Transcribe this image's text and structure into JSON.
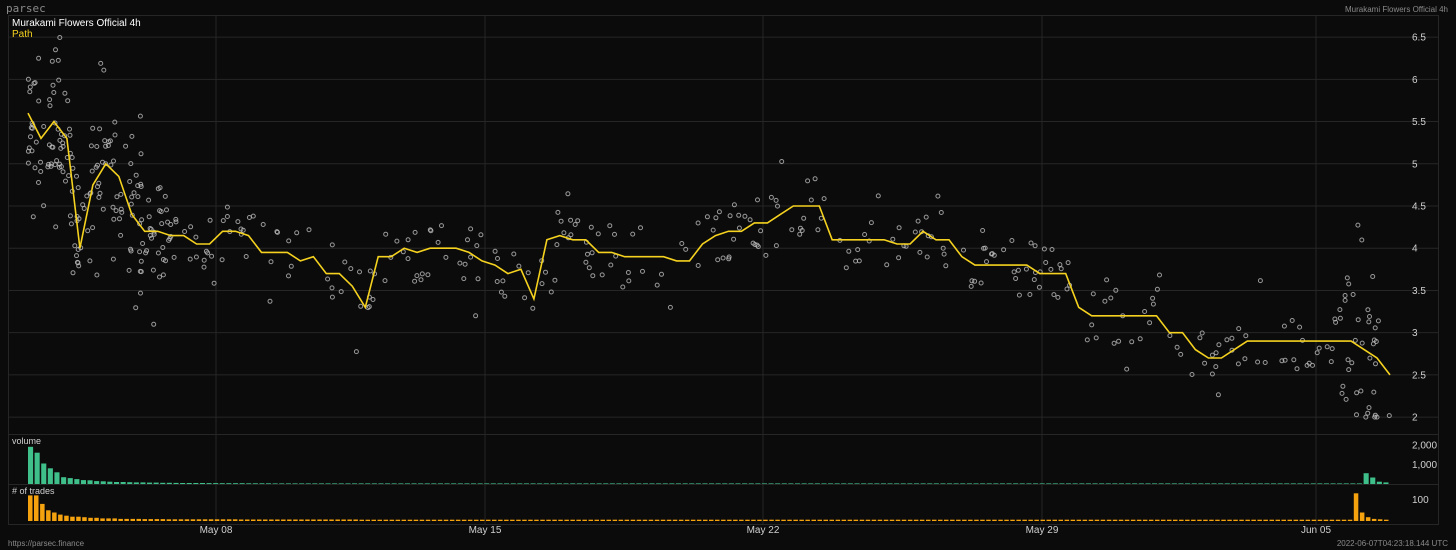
{
  "header": {
    "brand": "parsec",
    "window_label": "Murakami Flowers Official 4h"
  },
  "footer": {
    "url": "https://parsec.finance",
    "timestamp": "2022-06-07T04:23:18.144 UTC"
  },
  "colors": {
    "background": "#0b0b0b",
    "grid": "#262626",
    "path": "#f5d21f",
    "scatter": "#bdbdbd",
    "volume": "#3fbf8a",
    "trades": "#f5a20f",
    "title": "#ffffff"
  },
  "chart_data": [
    {
      "type": "scatter",
      "title": "Murakami Flowers Official 4h",
      "series": [
        {
          "name": "Path",
          "type": "line",
          "x": [
            0,
            2,
            4,
            6,
            8,
            10,
            12,
            14,
            16,
            18,
            20,
            22,
            24,
            26,
            28,
            30,
            32,
            34,
            36,
            38,
            40,
            42,
            44,
            46,
            48,
            50,
            52,
            54,
            56,
            58,
            60,
            62,
            64,
            66,
            68,
            70,
            72,
            74,
            76,
            78,
            80,
            82,
            84,
            86,
            88,
            90,
            92,
            94,
            96,
            98,
            100,
            102,
            104,
            106,
            108,
            110,
            112,
            114,
            116,
            118,
            120,
            122,
            124,
            126,
            128,
            130,
            132,
            134,
            136,
            138,
            140,
            142,
            144,
            146,
            148,
            150,
            152,
            154,
            156,
            158,
            160,
            162,
            164,
            166,
            168,
            170,
            172,
            174,
            176,
            178,
            180,
            182,
            184,
            186,
            188,
            190,
            192,
            194,
            196,
            198,
            200,
            202,
            204,
            206,
            208,
            210
          ],
          "y": [
            5.6,
            5.3,
            5.5,
            5.3,
            4.0,
            4.75,
            5.0,
            4.85,
            4.4,
            4.2,
            4.2,
            4.15,
            4.15,
            4.05,
            4.05,
            4.2,
            4.2,
            4.15,
            3.95,
            3.95,
            3.95,
            3.85,
            3.9,
            3.7,
            3.7,
            3.55,
            3.3,
            3.9,
            3.9,
            4.0,
            3.95,
            4.0,
            4.0,
            4.0,
            3.95,
            3.85,
            3.8,
            3.7,
            3.75,
            3.4,
            4.1,
            4.15,
            4.1,
            4.1,
            3.95,
            3.95,
            3.9,
            3.9,
            3.9,
            3.9,
            3.85,
            3.85,
            4.05,
            4.15,
            4.2,
            4.2,
            4.3,
            4.3,
            4.4,
            4.5,
            4.5,
            4.5,
            4.1,
            4.1,
            4.1,
            4.1,
            4.1,
            4.05,
            4.05,
            4.2,
            4.1,
            4.1,
            3.9,
            3.8,
            3.8,
            3.8,
            3.8,
            3.8,
            3.7,
            3.7,
            3.7,
            3.3,
            3.2,
            3.2,
            3.2,
            3.2,
            3.2,
            3.2,
            3.0,
            3.0,
            2.8,
            2.7,
            2.7,
            2.8,
            2.9,
            2.9,
            2.9,
            2.9,
            2.9,
            2.9,
            2.9,
            2.9,
            2.9,
            2.8,
            2.7,
            2.5
          ]
        }
      ],
      "x_ticks": [
        "May 08",
        "May 15",
        "May 22",
        "May 29",
        "Jun 05"
      ],
      "y_ticks": [
        2,
        2.5,
        3,
        3.5,
        4,
        4.5,
        5,
        5.5,
        6,
        6.5
      ],
      "ylim": [
        1.8,
        6.75
      ],
      "grid": true,
      "legend_position": "top-left"
    },
    {
      "type": "bar",
      "title": "volume",
      "y_ticks": [
        1000,
        2000
      ],
      "ylim": [
        0,
        2300
      ],
      "values": [
        1900,
        1600,
        1050,
        800,
        600,
        350,
        300,
        250,
        200,
        190,
        150,
        140,
        120,
        100,
        100,
        90,
        80,
        80,
        70,
        70,
        60,
        60,
        55,
        50,
        50,
        50,
        50,
        45,
        45,
        40,
        40,
        40,
        40,
        35,
        35,
        35,
        35,
        30,
        30,
        30,
        30,
        30,
        30,
        30,
        30,
        30,
        30,
        30,
        30,
        30,
        30,
        30,
        30,
        30,
        30,
        30,
        30,
        30,
        30,
        30,
        30,
        30,
        30,
        30,
        30,
        30,
        30,
        30,
        30,
        30,
        30,
        30,
        30,
        30,
        30,
        30,
        30,
        30,
        30,
        30,
        30,
        30,
        30,
        30,
        30,
        30,
        30,
        30,
        30,
        30,
        30,
        30,
        30,
        30,
        30,
        30,
        30,
        30,
        30,
        30,
        30,
        30,
        30,
        30,
        30,
        30,
        30,
        30,
        30,
        30,
        30,
        30,
        30,
        30,
        30,
        30,
        30,
        30,
        30,
        30,
        30,
        30,
        30,
        30,
        30,
        30,
        30,
        30,
        30,
        30,
        30,
        30,
        30,
        30,
        30,
        30,
        30,
        30,
        30,
        30,
        30,
        30,
        30,
        30,
        30,
        30,
        30,
        30,
        30,
        30,
        30,
        30,
        30,
        30,
        30,
        30,
        30,
        30,
        30,
        30,
        30,
        30,
        30,
        30,
        30,
        30,
        30,
        30,
        30,
        30,
        30,
        30,
        30,
        30,
        30,
        30,
        30,
        30,
        30,
        30,
        30,
        30,
        30,
        30,
        30,
        30,
        30,
        30,
        30,
        30,
        30,
        30,
        30,
        30,
        30,
        30,
        30,
        30,
        30,
        30,
        30,
        30,
        550,
        330,
        120,
        80
      ]
    },
    {
      "type": "bar",
      "title": "# of trades",
      "y_ticks": [
        100
      ],
      "ylim": [
        0,
        150
      ],
      "values": [
        120,
        120,
        80,
        50,
        40,
        30,
        25,
        20,
        20,
        18,
        15,
        15,
        12,
        12,
        12,
        10,
        10,
        10,
        10,
        9,
        9,
        9,
        9,
        8,
        8,
        8,
        8,
        8,
        8,
        8,
        8,
        8,
        8,
        8,
        8,
        7,
        7,
        7,
        7,
        7,
        7,
        7,
        7,
        7,
        7,
        7,
        7,
        7,
        7,
        7,
        7,
        7,
        7,
        7,
        7,
        6,
        6,
        6,
        6,
        6,
        6,
        6,
        6,
        6,
        6,
        6,
        6,
        6,
        6,
        6,
        6,
        6,
        6,
        6,
        6,
        6,
        6,
        6,
        6,
        6,
        6,
        6,
        6,
        6,
        6,
        6,
        6,
        6,
        6,
        6,
        6,
        6,
        6,
        6,
        6,
        6,
        6,
        6,
        6,
        6,
        6,
        6,
        6,
        6,
        6,
        6,
        6,
        6,
        6,
        6,
        6,
        6,
        6,
        6,
        6,
        6,
        6,
        6,
        6,
        6,
        6,
        6,
        6,
        6,
        6,
        6,
        6,
        6,
        6,
        6,
        6,
        6,
        6,
        6,
        6,
        6,
        6,
        6,
        6,
        6,
        6,
        6,
        6,
        6,
        6,
        6,
        6,
        6,
        6,
        6,
        6,
        6,
        6,
        6,
        6,
        6,
        6,
        6,
        6,
        6,
        6,
        6,
        6,
        6,
        6,
        6,
        6,
        6,
        6,
        6,
        6,
        6,
        6,
        6,
        6,
        6,
        6,
        6,
        6,
        6,
        6,
        6,
        6,
        6,
        6,
        6,
        6,
        6,
        6,
        6,
        6,
        6,
        6,
        6,
        6,
        6,
        6,
        6,
        6,
        6,
        6,
        6,
        6,
        6,
        6,
        6,
        6,
        6,
        6,
        6,
        6,
        6,
        6,
        6,
        6,
        6,
        6,
        6,
        6,
        6,
        130,
        40,
        18,
        10,
        8,
        6
      ]
    }
  ]
}
